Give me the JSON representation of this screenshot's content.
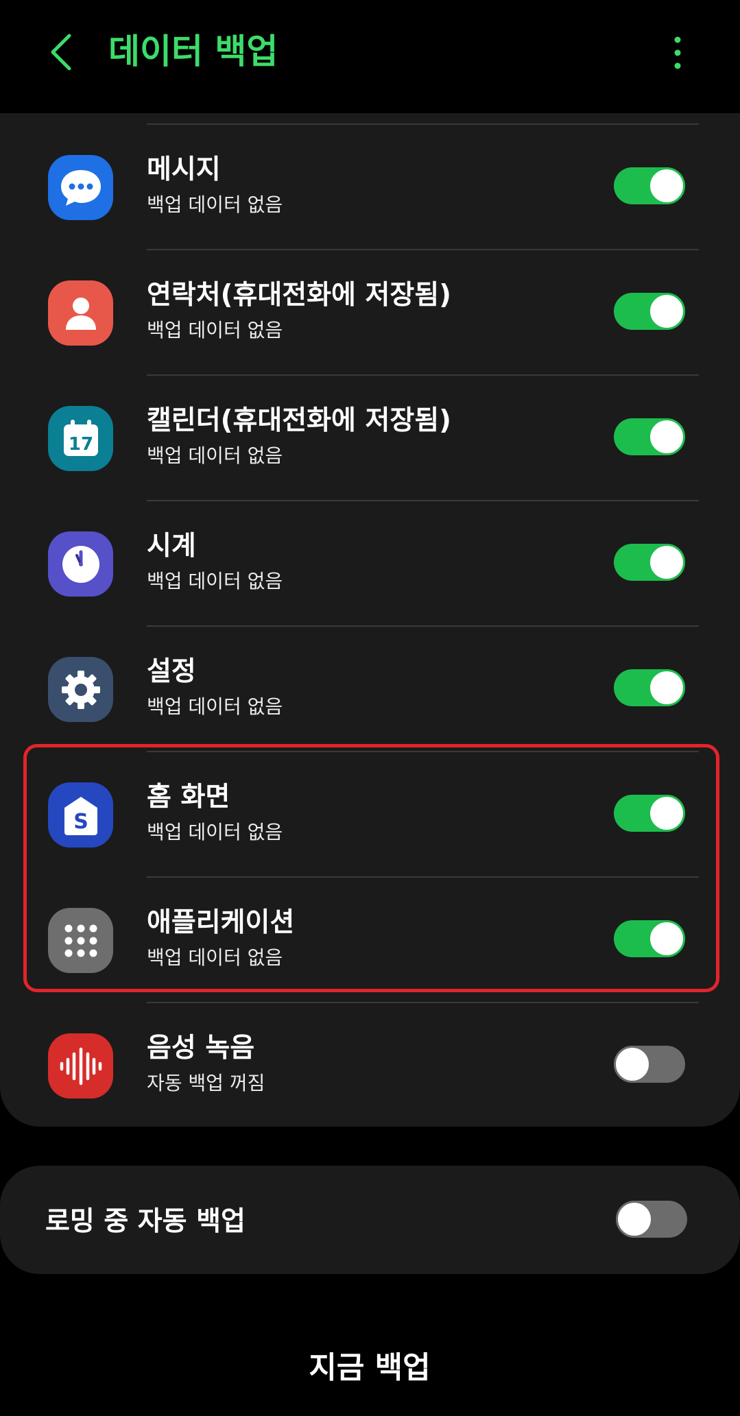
{
  "colors": {
    "accent": "#3ddc6a",
    "toggle_on": "#1dbd4d",
    "toggle_off": "#6c6c6c",
    "highlight": "#e3242b",
    "card_bg": "#1b1b1b"
  },
  "header": {
    "title": "데이터 백업",
    "back_icon": "chevron-left-icon",
    "more_icon": "more-vertical-icon"
  },
  "apps": [
    {
      "label": "메시지",
      "status": "백업 데이터 없음",
      "icon": "messages-icon",
      "color": "#1f6fe5",
      "enabled": true
    },
    {
      "label": "연락처(휴대전화에 저장됨)",
      "status": "백업 데이터 없음",
      "icon": "contacts-icon",
      "color": "#e8584a",
      "enabled": true
    },
    {
      "label": "캘린더(휴대전화에 저장됨)",
      "status": "백업 데이터 없음",
      "icon": "calendar-icon",
      "color": "#0b7f93",
      "enabled": true,
      "icon_text": "17"
    },
    {
      "label": "시계",
      "status": "백업 데이터 없음",
      "icon": "clock-icon",
      "color": "#5650c9",
      "enabled": true
    },
    {
      "label": "설정",
      "status": "백업 데이터 없음",
      "icon": "settings-gear-icon",
      "color": "#3a4f6d",
      "enabled": true
    },
    {
      "label": "홈 화면",
      "status": "백업 데이터 없음",
      "icon": "home-screen-icon",
      "color": "#2548c0",
      "enabled": true,
      "icon_text": "S"
    },
    {
      "label": "애플리케이션",
      "status": "백업 데이터 없음",
      "icon": "apps-grid-icon",
      "color": "#6e6e6e",
      "enabled": true
    },
    {
      "label": "음성 녹음",
      "status": "자동 백업 꺼짐",
      "icon": "voice-recorder-icon",
      "color": "#d62d2a",
      "enabled": false
    }
  ],
  "roaming": {
    "label": "로밍 중 자동 백업",
    "enabled": false
  },
  "backup_now_label": "지금 백업"
}
